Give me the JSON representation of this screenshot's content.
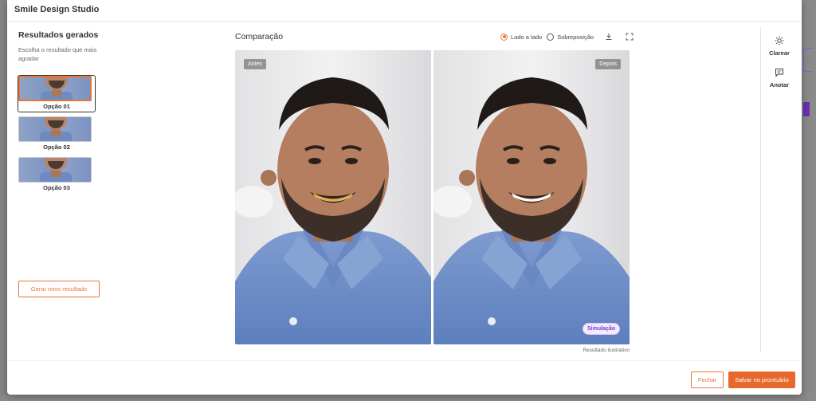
{
  "modal": {
    "title": "Smile Design Studio"
  },
  "results": {
    "heading": "Resultados gerados",
    "subtitle": "Escolha o resultado que mais agradar",
    "options": [
      {
        "label": "Opção 01",
        "selected": true
      },
      {
        "label": "Opção 02",
        "selected": false
      },
      {
        "label": "Opção 03",
        "selected": false
      }
    ],
    "generate_label": "Gerar novo resultado"
  },
  "comparison": {
    "title": "Comparação",
    "modes": [
      {
        "label": "Lado a lado",
        "selected": true
      },
      {
        "label": "Sobreposição",
        "selected": false
      }
    ],
    "icons": [
      "download-icon",
      "fullscreen-icon"
    ],
    "before_tag": "Antes",
    "after_tag": "Depois",
    "simulation_badge": "Simulação",
    "disclaimer": "Resultado ilustrativo"
  },
  "tools": [
    {
      "label": "Clarear",
      "icon": "sun-icon"
    },
    {
      "label": "Anotar",
      "icon": "comment-icon"
    }
  ],
  "footer": {
    "close_label": "Fechar",
    "save_label": "Salvar no prontuário"
  },
  "colors": {
    "accent": "#e8763a",
    "primary_button": "#e8692c",
    "simulation_badge": "#7b3fd0"
  }
}
